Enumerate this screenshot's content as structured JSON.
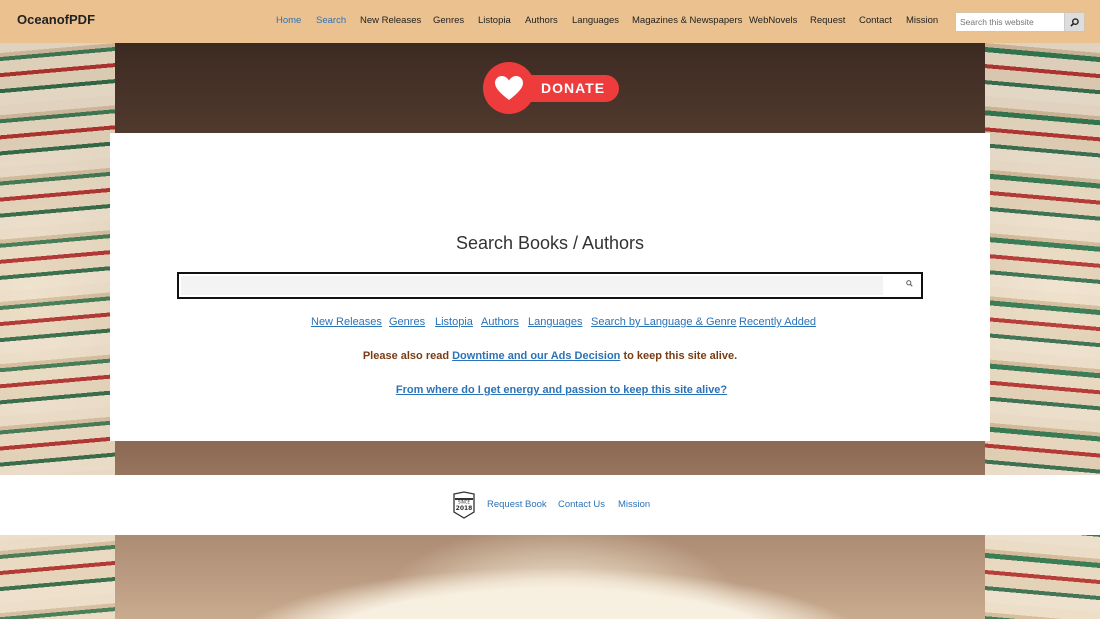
{
  "site": {
    "name": "OceanofPDF"
  },
  "nav": {
    "items": [
      {
        "label": "Home",
        "active": true
      },
      {
        "label": "Search",
        "active": true
      },
      {
        "label": "New Releases",
        "active": false
      },
      {
        "label": "Genres",
        "active": false
      },
      {
        "label": "Listopia",
        "active": false
      },
      {
        "label": "Authors",
        "active": false
      },
      {
        "label": "Languages",
        "active": false
      },
      {
        "label": "Magazines & Newspapers",
        "active": false
      },
      {
        "label": "WebNovels",
        "active": false
      },
      {
        "label": "Request",
        "active": false
      },
      {
        "label": "Contact",
        "active": false
      },
      {
        "label": "Mission",
        "active": false
      }
    ],
    "search": {
      "placeholder": "Search this website",
      "icon": "search-icon"
    }
  },
  "donate": {
    "label": "DONATE",
    "icon": "heart-icon"
  },
  "main": {
    "title": "Search Books / Authors",
    "search": {
      "value": "",
      "icon": "search-icon"
    },
    "links": [
      "New Releases",
      "Genres",
      "Listopia",
      "Authors",
      "Languages",
      "Search by Language & Genre",
      "Recently Added"
    ],
    "notice": {
      "prefix": "Please also read ",
      "link": "Downtime and our Ads Decision",
      "suffix": " to keep this site alive."
    },
    "energy_link": "From where do I get energy and passion to keep this site alive?"
  },
  "footer": {
    "badge": {
      "top": "SINCE",
      "year": "2018"
    },
    "links": [
      "Request Book",
      "Contact Us",
      "Mission"
    ]
  },
  "colors": {
    "header_bg": "#ebc28f",
    "link": "#2b73b8",
    "donate": "#ee3b3b",
    "notice_text": "#7a3b12"
  }
}
